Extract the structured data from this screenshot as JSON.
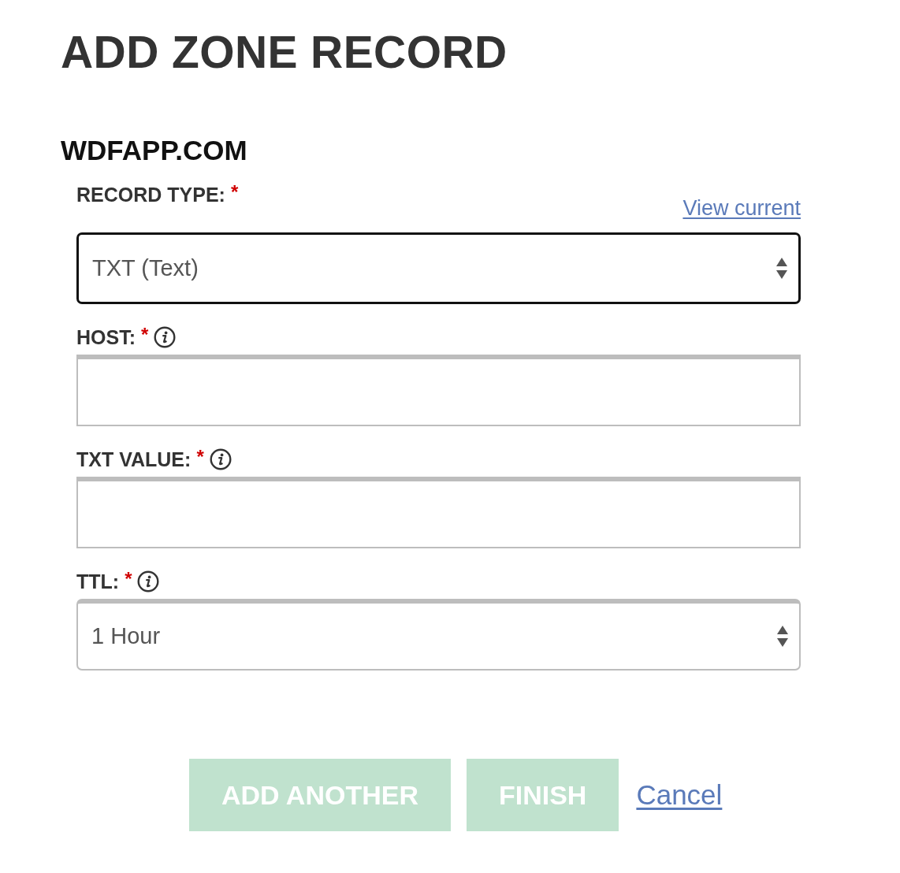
{
  "title": "ADD ZONE RECORD",
  "domain": "WDFAPP.COM",
  "view_link": "View current",
  "fields": [
    {
      "kind": "select",
      "label": "RECORD TYPE:",
      "required_mark": "*",
      "info": false,
      "focused": true,
      "value": "TXT (Text)"
    },
    {
      "kind": "text",
      "label": "HOST:",
      "required_mark": "*",
      "info": true,
      "focused": false
    },
    {
      "kind": "text",
      "label": "TXT VALUE:",
      "required_mark": "*",
      "info": true,
      "focused": false
    },
    {
      "kind": "select",
      "label": "TTL:",
      "required_mark": "*",
      "info": true,
      "focused": false,
      "value": "1 Hour"
    }
  ],
  "buttons": [
    {
      "label": "ADD ANOTHER",
      "disabled": true
    },
    {
      "label": "FINISH",
      "disabled": true
    }
  ],
  "cancel_link": "Cancel"
}
